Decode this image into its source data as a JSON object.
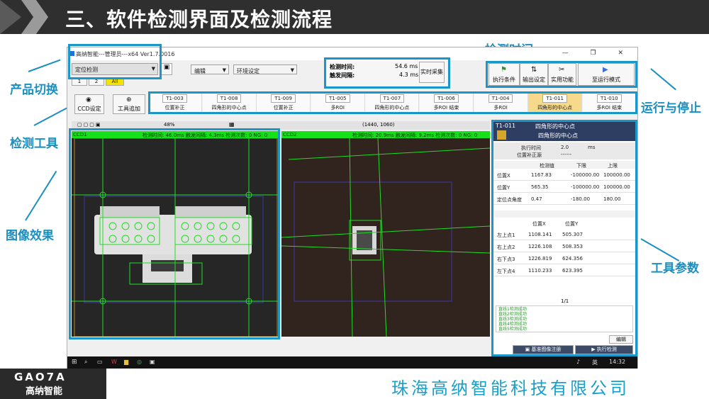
{
  "slide": {
    "title": "三、软件检测界面及检测流程",
    "company": "珠海高纳智能科技有限公司",
    "logo_line1": "GAO7A",
    "logo_line2": "高纳智能",
    "colors": {
      "accent": "#1a96c8",
      "green": "#15e01a",
      "dark": "#2f2f2f"
    }
  },
  "annotations": {
    "product_switch": "产品切换",
    "detect_tools": "检测工具",
    "image_effect": "图像效果",
    "detect_time": "检测时间",
    "run_stop": "运行与停止",
    "tool_params": "工具参数"
  },
  "app": {
    "window_title": "高纳智能---管理员---x64 Ver1.7.0016",
    "window_controls": "—  ❐  ✕",
    "product_combo": "定位检测",
    "tabs": [
      "1",
      "2",
      "All"
    ],
    "menu_edit": "编辑",
    "menu_env": "环境设定",
    "timing": {
      "detect_label": "检测时间:",
      "detect_value": "54.6 ms",
      "trigger_label": "触发间隔:",
      "trigger_value": "4.3 ms",
      "realtime_button": "实时采集"
    },
    "run_buttons": [
      "执行条件",
      "输出设定",
      "实用功能",
      "至运行模式"
    ],
    "left_buttons": {
      "ccd": "CCD设定",
      "add_tool": "工具追加"
    },
    "tools": [
      {
        "id": "T1-003",
        "label": "位置补正"
      },
      {
        "id": "T1-008",
        "label": "四角形的中心点"
      },
      {
        "id": "T1-009",
        "label": "位置补正"
      },
      {
        "id": "T1-005",
        "label": "多ROI"
      },
      {
        "id": "T1-007",
        "label": "四角形的中心点"
      },
      {
        "id": "T1-006",
        "label": "多ROI 结束"
      },
      {
        "id": "T1-004",
        "label": "多ROI"
      },
      {
        "id": "T1-011",
        "label": "四角形的中心点"
      },
      {
        "id": "T1-010",
        "label": "多ROI 结束"
      }
    ],
    "zoom": "48%",
    "coords": "(1440, 1060)",
    "ccd1": {
      "name": "CCD1",
      "stats": "检测时间:  46.0ms  触发间隔:  4.3ms  检测次数:  0  NG:  0"
    },
    "ccd2": {
      "name": "CCD2",
      "stats": "检测时间:  20.9ms  触发间隔:  9.2ms  检测次数:  0  NG:  0"
    },
    "params": {
      "tool_id": "T1-011",
      "tool_title": "四角形的中心点",
      "tool_subtitle": "四角形的中心点",
      "exec_time_label": "执行时间",
      "exec_time_value": "2.0",
      "exec_time_unit": "ms",
      "pos_source_label": "位置补正源",
      "pos_source_value": "------",
      "col_detect": "检测值",
      "col_low": "下限",
      "col_high": "上限",
      "rows": [
        {
          "name": "位置X",
          "detect": "1167.83",
          "low": "-100000.00",
          "high": "100000.00"
        },
        {
          "name": "位置Y",
          "detect": "565.35",
          "low": "-100000.00",
          "high": "100000.00"
        },
        {
          "name": "定位点角度",
          "detect": "0.47",
          "low": "-180.00",
          "high": "180.00"
        }
      ],
      "col_px": "位置X",
      "col_py": "位置Y",
      "corners": [
        {
          "name": "左上点1",
          "x": "1108.141",
          "y": "505.307"
        },
        {
          "name": "右上点2",
          "x": "1226.108",
          "y": "508.353"
        },
        {
          "name": "右下点3",
          "x": "1226.819",
          "y": "624.356"
        },
        {
          "name": "左下点4",
          "x": "1110.233",
          "y": "623.395"
        }
      ],
      "page": "1/1",
      "log": [
        "直线1检测成功",
        "直线2检测成功",
        "直线3检测成功",
        "直线4检测成功",
        "直线5检测成功"
      ],
      "edit_button": "编辑",
      "register_button": "基准图像注册",
      "run_button": "执行检测"
    },
    "taskbar": {
      "lang": "英",
      "time": "14:32"
    }
  }
}
